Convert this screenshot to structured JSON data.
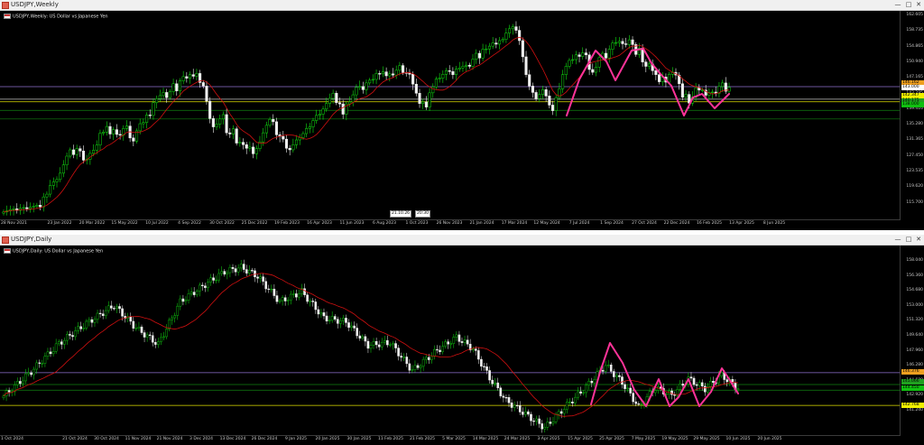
{
  "weekly": {
    "window_title": "USDJPY,Weekly",
    "symbol_line": "USDJPY,Weekly:  US Dollar vs Japanese Yen",
    "price_labels": [
      "162.605",
      "158.735",
      "154.865",
      "150.940",
      "147.165",
      "143.285",
      "139.410",
      "135.280",
      "131.365",
      "127.450",
      "123.535",
      "119.620",
      "115.700"
    ],
    "price_tags": [
      {
        "text": "146.162",
        "color": "#f0a020"
      },
      {
        "text": "143.000",
        "color": "#ffffff"
      },
      {
        "text": "142.347",
        "color": "#f0f000"
      },
      {
        "text": "140.175",
        "color": "#20a020"
      },
      {
        "text": "138.000",
        "color": "#10c010"
      }
    ],
    "time_labels": [
      "28 Nov 2021",
      "23 Jan 2022",
      "20 Mar 2022",
      "15 May 2022",
      "10 Jul 2022",
      "4 Sep 2022",
      "30 Oct 2022",
      "25 Dec 2022",
      "19 Feb 2023",
      "16 Apr 2023",
      "11 Jun 2023",
      "6 Aug 2023",
      "1 Oct 2023",
      "26 Nov 2023",
      "21 Jan 2024",
      "17 Mar 2024",
      "12 May 2024",
      "7 Jul 2024",
      "1 Sep 2024",
      "27 Oct 2024",
      "22 Dec 2024",
      "16 Feb 2025",
      "13 Apr 2025",
      "8 Jun 2025"
    ],
    "crosshair_time": "21.10.26",
    "crosshair_hour": "20:30",
    "close_prices": [
      114.5,
      114.8,
      115.1,
      115.3,
      114.9,
      115.4,
      115.6,
      115.3,
      115.7,
      115.9,
      116.2,
      115.8,
      118.3,
      119.0,
      121.2,
      122.1,
      122.7,
      124.3,
      126.4,
      128.6,
      130.2,
      129.0,
      130.5,
      129.9,
      127.6,
      127.8,
      129.3,
      130.1,
      131.4,
      134.4,
      134.7,
      136.1,
      134.2,
      135.3,
      134.1,
      133.9,
      135.6,
      136.2,
      133.2,
      132.4,
      135.0,
      136.8,
      137.1,
      139.0,
      138.9,
      142.1,
      143.1,
      143.9,
      144.7,
      143.4,
      144.9,
      146.9,
      145.1,
      147.6,
      148.7,
      148.3,
      149.2,
      148.8,
      149.5,
      147.2,
      146.3,
      142.5,
      138.1,
      136.0,
      136.7,
      138.0,
      139.1,
      134.5,
      134.2,
      135.5,
      131.9,
      132.1,
      131.5,
      130.6,
      130.9,
      129.2,
      130.5,
      132.2,
      134.5,
      136.4,
      137.9,
      137.3,
      134.0,
      133.6,
      132.9,
      130.6,
      130.2,
      131.5,
      132.7,
      133.3,
      134.3,
      135.6,
      136.0,
      137.6,
      138.9,
      139.2,
      140.5,
      141.9,
      143.2,
      144.5,
      142.1,
      141.8,
      139.2,
      141.8,
      142.3,
      144.1,
      146.0,
      146.2,
      145.4,
      147.1,
      147.8,
      148.0,
      149.5,
      149.4,
      149.9,
      148.9,
      149.4,
      149.1,
      150.3,
      151.5,
      149.7,
      149.6,
      149.3,
      146.8,
      144.5,
      141.9,
      142.3,
      141.0,
      144.6,
      146.1,
      148.1,
      148.3,
      149.3,
      150.2,
      150.0,
      149.2,
      150.6,
      150.9,
      151.3,
      151.6,
      151.3,
      153.1,
      154.6,
      153.4,
      155.6,
      155.7,
      156.4,
      157.2,
      156.9,
      157.8,
      158.1,
      159.7,
      160.8,
      161.3,
      160.4,
      157.8,
      153.7,
      149.2,
      146.3,
      144.7,
      143.1,
      144.2,
      145.4,
      143.8,
      141.5,
      140.1,
      143.4,
      145.6,
      149.2,
      151.3,
      152.8,
      153.0,
      154.2,
      153.8,
      154.7,
      154.2,
      150.5,
      149.8,
      151.1,
      153.5,
      154.6,
      153.4,
      155.6,
      157.2,
      157.3,
      157.6,
      157.0,
      156.8,
      158.0,
      156.8,
      154.3,
      155.9,
      152.4,
      151.3,
      151.9,
      150.2,
      149.2,
      147.4,
      148.6,
      147.3,
      149.3,
      149.8,
      149.1,
      146.9,
      143.5,
      144.2,
      142.0,
      143.5,
      145.9,
      145.3,
      145.3,
      144.0,
      144.7,
      144.8,
      144.5,
      146.2,
      147.1,
      145.0,
      146.0
    ]
  },
  "daily": {
    "window_title": "USDJPY,Daily",
    "symbol_line": "USDJPY,Daily:  US Dollar vs Japanese Yen",
    "price_labels": [
      "158.040",
      "156.360",
      "154.680",
      "153.000",
      "151.320",
      "149.640",
      "147.960",
      "146.280",
      "144.600",
      "142.920",
      "141.240"
    ],
    "price_tags": [
      {
        "text": "146.376",
        "color": "#f0a020"
      },
      {
        "text": "145.066",
        "color": "#20a020"
      },
      {
        "text": "144.450",
        "color": "#10c010"
      },
      {
        "text": "142.768",
        "color": "#f0f000"
      }
    ],
    "time_labels": [
      "1 Oct 2024",
      "21 Oct 2024",
      "30 Oct 2024",
      "11 Nov 2024",
      "21 Nov 2024",
      "3 Dec 2024",
      "13 Dec 2024",
      "26 Dec 2024",
      "9 Jan 2025",
      "20 Jan 2025",
      "30 Jan 2025",
      "11 Feb 2025",
      "21 Feb 2025",
      "5 Mar 2025",
      "14 Mar 2025",
      "24 Mar 2025",
      "3 Apr 2025",
      "15 Apr 2025",
      "25 Apr 2025",
      "7 May 2025",
      "19 May 2025",
      "29 May 2025",
      "10 Jun 2025",
      "20 Jun 2025"
    ]
  },
  "colors": {
    "bull": "#10e010",
    "bear": "#f0f0f0",
    "ma": "#d01010",
    "pattern": "#ff3399",
    "purple_line": "#9070d0",
    "yellow_line": "#e0e000",
    "green_line": "#108010"
  },
  "window_controls": {
    "minimize": "—",
    "maximize": "□",
    "close": "✕"
  }
}
